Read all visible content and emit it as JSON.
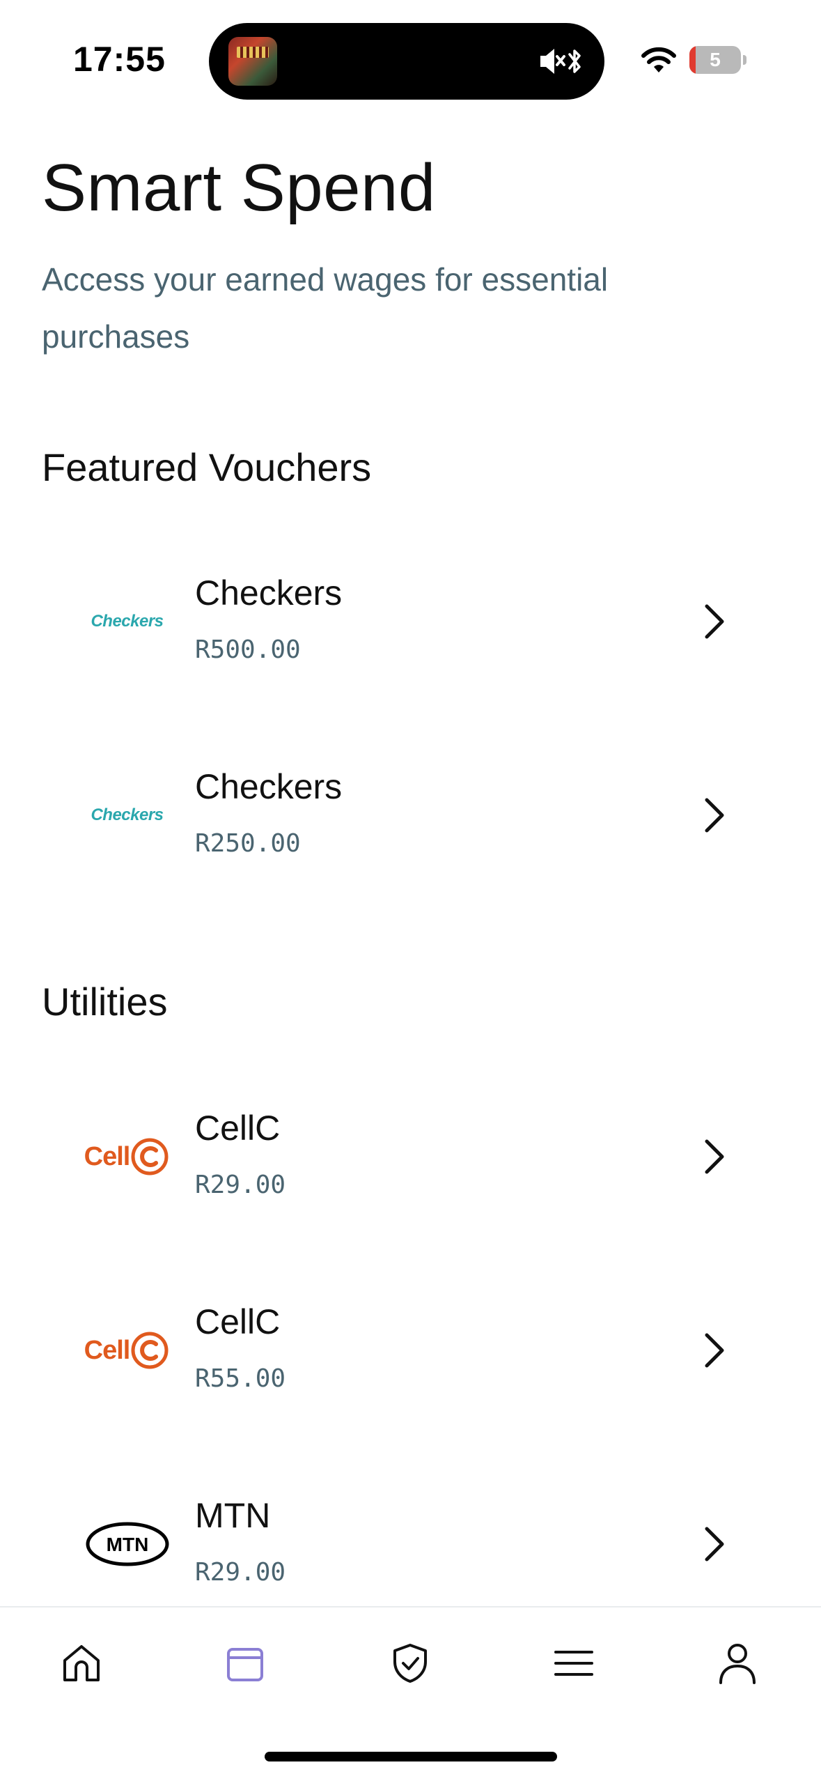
{
  "status_bar": {
    "time": "17:55",
    "battery_level": "5",
    "battery_fraction": 0.05,
    "icons": [
      "music-artwork-icon",
      "mute-icon",
      "bluetooth-icon",
      "wifi-icon",
      "battery-icon"
    ]
  },
  "header": {
    "title": "Smart Spend",
    "subtitle": "Access your earned wages for essential purchases"
  },
  "sections": {
    "featured": {
      "title": "Featured Vouchers",
      "items": [
        {
          "logo_text": "Checkers",
          "name": "Checkers",
          "price": "R500.00"
        },
        {
          "logo_text": "Checkers",
          "name": "Checkers",
          "price": "R250.00"
        }
      ]
    },
    "utilities": {
      "title": "Utilities",
      "items": [
        {
          "logo_text": "Cell",
          "name": "CellC",
          "price": "R29.00"
        },
        {
          "logo_text": "Cell",
          "name": "CellC",
          "price": "R55.00"
        },
        {
          "logo_text": "MTN",
          "name": "MTN",
          "price": "R29.00"
        }
      ]
    }
  },
  "colors": {
    "text": "#111111",
    "muted": "#4a6470",
    "checkers": "#2aa7ad",
    "cellc": "#e05a1e",
    "active_tab": "#8b7fd4",
    "tab_icon": "#111111"
  },
  "tab_bar": {
    "tabs": [
      {
        "icon": "home-icon",
        "active": false
      },
      {
        "icon": "wallet-icon",
        "active": true
      },
      {
        "icon": "shield-check-icon",
        "active": false
      },
      {
        "icon": "menu-icon",
        "active": false
      },
      {
        "icon": "profile-icon",
        "active": false
      }
    ]
  }
}
